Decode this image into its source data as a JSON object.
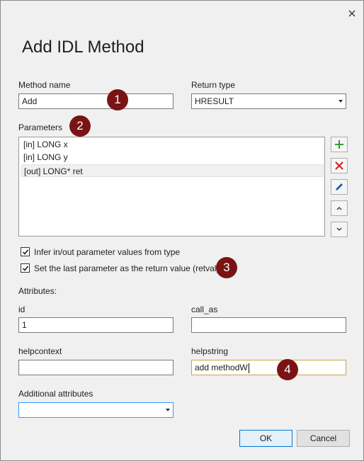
{
  "dialog": {
    "title": "Add IDL Method",
    "close_icon": "close-icon"
  },
  "method_name": {
    "label": "Method name",
    "value": "Add"
  },
  "return_type": {
    "label": "Return type",
    "value": "HRESULT"
  },
  "parameters": {
    "label": "Parameters",
    "items": [
      "[in] LONG x",
      "[in] LONG y",
      "[out] LONG* ret"
    ],
    "selected_index": 2
  },
  "side_buttons": {
    "add_icon": "plus-icon",
    "remove_icon": "x-icon",
    "edit_icon": "pencil-icon",
    "up_icon": "chevron-up-icon",
    "down_icon": "chevron-down-icon"
  },
  "checkboxes": {
    "infer": {
      "label": "Infer in/out parameter values from type",
      "checked": true
    },
    "retval": {
      "label": "Set the last parameter as the return value (retval)",
      "checked": true
    }
  },
  "attributes": {
    "heading": "Attributes:",
    "id": {
      "label": "id",
      "value": "1"
    },
    "call_as": {
      "label": "call_as",
      "value": ""
    },
    "helpcontext": {
      "label": "helpcontext",
      "value": ""
    },
    "helpstring": {
      "label": "helpstring",
      "value": "add methodW"
    },
    "additional": {
      "label": "Additional attributes",
      "value": ""
    }
  },
  "markers": [
    "1",
    "2",
    "3",
    "4"
  ],
  "buttons": {
    "ok": "OK",
    "cancel": "Cancel"
  },
  "colors": {
    "marker": "#7a1414",
    "add_green": "#2e9e2e",
    "remove_red": "#d02020",
    "edit_blue": "#1f5fa8",
    "focus_blue": "#3399ff"
  }
}
